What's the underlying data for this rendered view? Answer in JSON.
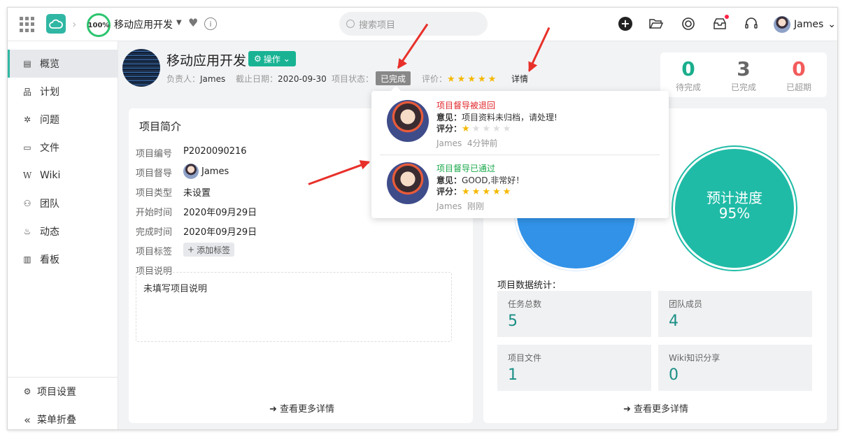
{
  "header": {
    "progress_ring": "100%",
    "project_name": "移动应用开发",
    "search_placeholder": "搜索项目",
    "user_name": "James"
  },
  "sidebar": {
    "items": [
      {
        "label": "概览",
        "icon": "overview-icon"
      },
      {
        "label": "计划",
        "icon": "plan-icon"
      },
      {
        "label": "问题",
        "icon": "bug-icon"
      },
      {
        "label": "文件",
        "icon": "folder-icon"
      },
      {
        "label": "Wiki",
        "icon": "wiki-icon"
      },
      {
        "label": "团队",
        "icon": "team-icon"
      },
      {
        "label": "动态",
        "icon": "activity-icon"
      },
      {
        "label": "看板",
        "icon": "board-icon"
      }
    ],
    "settings": "项目设置",
    "collapse": "菜单折叠"
  },
  "project": {
    "title": "移动应用开发",
    "op_button": "操作",
    "owner_label": "负责人：",
    "owner": "James",
    "deadline_label": "截止日期：",
    "deadline": "2020-09-30",
    "status_label": "项目状态：",
    "status": "已完成",
    "rating_label": "评价：",
    "detail": "详情"
  },
  "stats": [
    {
      "value": "0",
      "label": "待完成",
      "color": "#1aae8c"
    },
    {
      "value": "3",
      "label": "已完成",
      "color": "#666666"
    },
    {
      "value": "0",
      "label": "已超期",
      "color": "#f35b5b"
    }
  ],
  "intro": {
    "title": "项目简介",
    "fields": {
      "code_label": "项目编号",
      "code": "P2020090216",
      "supervisor_label": "项目督导",
      "supervisor": "James",
      "type_label": "项目类型",
      "type": "未设置",
      "start_label": "开始时间",
      "start": "2020年09月29日",
      "end_label": "完成时间",
      "end": "2020年09月29日",
      "tag_label": "项目标签",
      "tag_button": "添加标签",
      "desc_label": "项目说明",
      "desc": "未填写项目说明"
    },
    "more": "查看更多详情"
  },
  "popup": {
    "items": [
      {
        "title": "项目督导被退回",
        "title_color": "#e0262b",
        "opinion_label": "意见：",
        "opinion": "项目资料未归档，请处理!",
        "score_label": "评分：",
        "rating": 1,
        "author": "James",
        "time": "4分钟前"
      },
      {
        "title": "项目督导已通过",
        "title_color": "#18a84a",
        "opinion_label": "意见：",
        "opinion": "GOOD,非常好！",
        "score_label": "评分：",
        "rating": 5,
        "author": "James",
        "time": "刚刚"
      }
    ]
  },
  "progress": {
    "forecast_label": "预计进度",
    "forecast_value": "95%",
    "stats_title": "项目数据统计：",
    "tiles": [
      {
        "label": "任务总数",
        "value": "5"
      },
      {
        "label": "团队成员",
        "value": "4"
      },
      {
        "label": "项目文件",
        "value": "1"
      },
      {
        "label": "Wiki知识分享",
        "value": "0"
      }
    ],
    "more": "查看更多详情"
  }
}
